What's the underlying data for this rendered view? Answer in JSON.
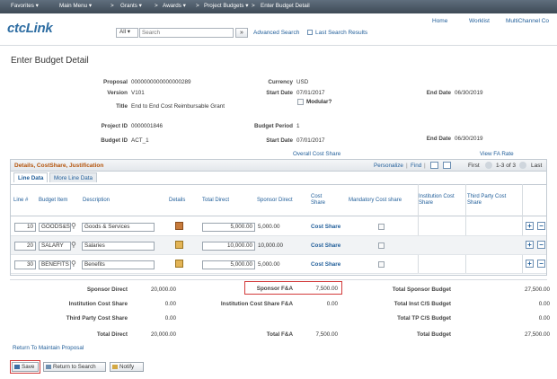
{
  "nav": {
    "favorites": "Favorites ▾",
    "main_menu": "Main Menu ▾",
    "sep1": ">",
    "grants": "Grants ▾",
    "sep2": ">",
    "awards": "Awards ▾",
    "sep3": ">",
    "project_budgets": "Project Budgets ▾",
    "sep4": ">",
    "enter_budget": "Enter Budget Detail"
  },
  "header": {
    "logo_prefix": "ct",
    "logo_text": "ctcLink",
    "logo_main": "ctcLink",
    "scope": "All",
    "search_placeholder": "Search",
    "search_btn": "»",
    "advanced_search": "Advanced Search",
    "last_search": "Last Search Results",
    "home": "Home",
    "worklist": "Worklist",
    "multichannel": "MultiChannel Co"
  },
  "page_title": "Enter Budget Detail",
  "info": {
    "proposal_label": "Proposal",
    "proposal": "0000000000000000289",
    "version_label": "Version",
    "version": "V101",
    "title_label": "Title",
    "title": "End to End Cost Reimbursable Grant",
    "currency_label": "Currency",
    "currency": "USD",
    "start_label": "Start Date",
    "start": "07/01/2017",
    "end_label": "End Date",
    "end": "06/30/2019",
    "modular": "Modular?",
    "project_label": "Project ID",
    "project": "0000001846",
    "period_label": "Budget Period",
    "period": "1",
    "budget_id_label": "Budget ID",
    "budget_id": "ACT_1",
    "start2": "07/01/2017",
    "end2": "06/30/2019",
    "overall_cost_share": "Overall Cost Share",
    "view_fa_rate": "View FA Rate"
  },
  "grid": {
    "title": "Details, CostShare, Justification",
    "personalize": "Personalize",
    "find": "Find",
    "first": "First",
    "page_info": "1-3 of 3",
    "last": "Last",
    "tab_line_data": "Line Data",
    "tab_more": "More Line Data",
    "columns": {
      "line": "Line #",
      "item": "Budget Item",
      "desc": "Description",
      "details": "Details",
      "total_direct": "Total Direct",
      "sponsor_direct": "Sponsor Direct",
      "cost_share": "Cost Share",
      "mandatory": "Mandatory Cost share",
      "inst_cost": "Institution Cost Share",
      "third_party": "Third Party Cost Share"
    },
    "rows": [
      {
        "line": "10",
        "item": "GOODS&S",
        "desc": "Goods & Services",
        "total": "5,000.00",
        "sponsor": "5,000.00",
        "cost_share": "Cost Share"
      },
      {
        "line": "20",
        "item": "SALARY",
        "desc": "Salaries",
        "total": "10,000.00",
        "sponsor": "10,000.00",
        "cost_share": "Cost Share"
      },
      {
        "line": "30",
        "item": "BENEFITS",
        "desc": "Benefits",
        "total": "5,000.00",
        "sponsor": "5,000.00",
        "cost_share": "Cost Share"
      }
    ]
  },
  "totals": {
    "sponsor_direct_label": "Sponsor Direct",
    "sponsor_direct": "20,000.00",
    "sponsor_fa_label": "Sponsor F&A",
    "sponsor_fa": "7,500.00",
    "total_sponsor_budget_label": "Total Sponsor Budget",
    "total_sponsor_budget": "27,500.00",
    "inst_cost_share_label": "Institution Cost Share",
    "inst_cost_share": "0.00",
    "inst_cost_share_fa_label": "Institution Cost Share F&A",
    "inst_cost_share_fa": "0.00",
    "total_inst_label": "Total Inst C/S Budget",
    "total_inst": "0.00",
    "third_party_label": "Third Party Cost Share",
    "third_party": "0.00",
    "total_tp_label": "Total TP C/S Budget",
    "total_tp": "0.00",
    "total_direct_label": "Total Direct",
    "total_direct": "20,000.00",
    "total_fa_label": "Total F&A",
    "total_fa": "7,500.00",
    "total_budget_label": "Total Budget",
    "total_budget": "27,500.00"
  },
  "footer": {
    "return_link": "Return To Maintain Proposal",
    "save": "Save",
    "return_search": "Return to Search",
    "notify": "Notify"
  }
}
